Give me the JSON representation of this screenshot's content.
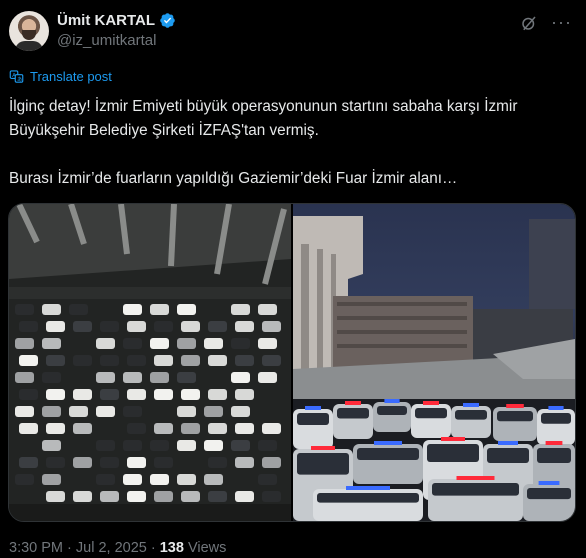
{
  "author": {
    "name": "Ümit KARTAL",
    "handle": "@iz_umitkartal",
    "verified_color": "#1d9bf0"
  },
  "actions": {
    "grok_icon": "grok-icon",
    "more_icon": "more-icon",
    "more_glyph": "···"
  },
  "translate": {
    "label": "Translate post",
    "icon": "translate-icon"
  },
  "post": {
    "text": "İlginç detay! İzmir Emiyeti büyük operasyonunun startını sabaha karşı İzmir Büyükşehir Belediye Şirketi İZFAŞ'tan vermiş.\n\nBurası İzmir’de fuarların yapıldığı Gaziemir’deki Fuar İzmir alanı…"
  },
  "media": {
    "images": [
      "aerial-parking-lot-photo",
      "police-cars-at-fair-photo"
    ]
  },
  "meta": {
    "time": "3:30 PM",
    "separator": " · ",
    "date": "Jul 2, 2025",
    "views_count": "138",
    "views_label": "Views"
  },
  "colors": {
    "accent": "#1d9bf0",
    "text": "#e7e9ea",
    "muted": "#71767b",
    "background": "#000000"
  }
}
